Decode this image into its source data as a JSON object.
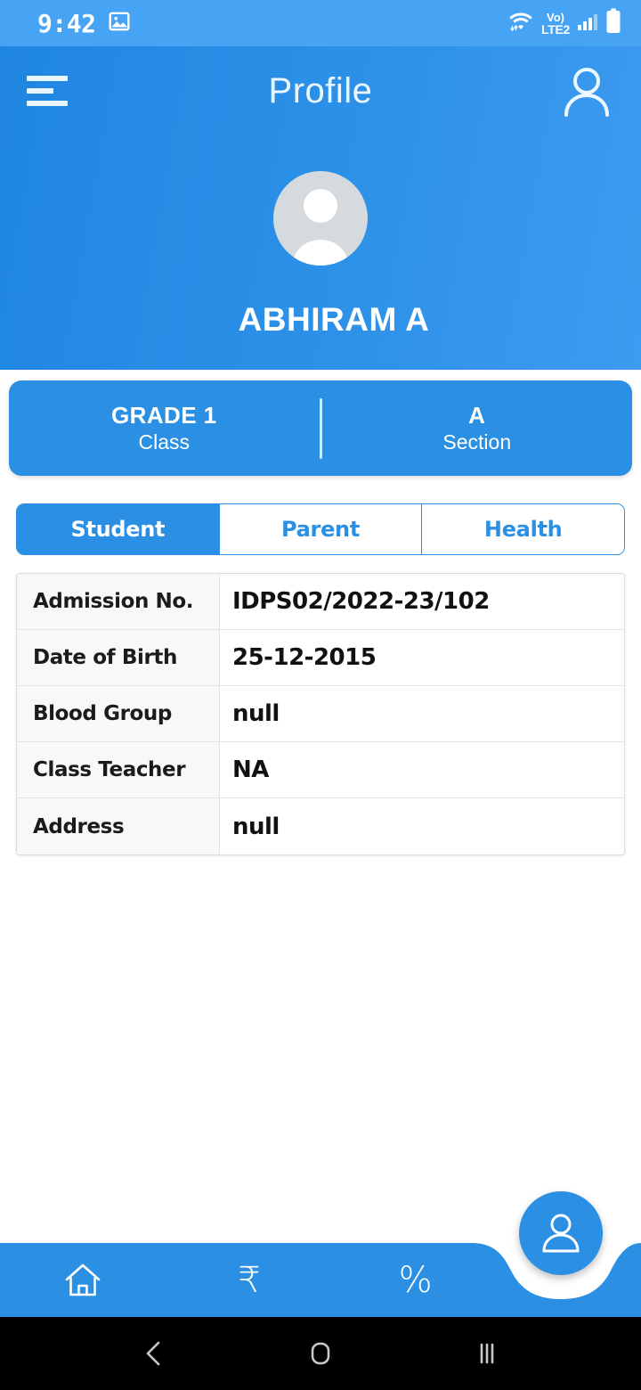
{
  "status_bar": {
    "time": "9:42",
    "icons": [
      "image-icon",
      "wifi-icon",
      "volte-icon",
      "signal-icon",
      "battery-icon"
    ],
    "volte_top": "Vo)",
    "volte_bottom": "LTE2"
  },
  "header": {
    "title": "Profile",
    "menu_icon": "hamburger-icon",
    "profile_icon": "person-icon",
    "student_name": "ABHIRAM A",
    "avatar_icon": "avatar-placeholder-icon",
    "bg_color": "#2b90e4"
  },
  "class_card": {
    "class_value": "GRADE 1",
    "class_label": "Class",
    "section_value": "A",
    "section_label": "Section",
    "bg_color": "#2b90e4"
  },
  "tabs": [
    {
      "label": "Student",
      "active": true
    },
    {
      "label": "Parent",
      "active": false
    },
    {
      "label": "Health",
      "active": false
    }
  ],
  "details": {
    "rows": [
      {
        "label": "Admission No.",
        "value": "IDPS02/2022-23/102"
      },
      {
        "label": "Date of Birth",
        "value": "25-12-2015"
      },
      {
        "label": "Blood Group",
        "value": "null"
      },
      {
        "label": "Class Teacher",
        "value": "NA"
      },
      {
        "label": "Address",
        "value": "null"
      }
    ]
  },
  "bottom_nav": {
    "items": [
      {
        "icon": "home-icon",
        "symbol": ""
      },
      {
        "icon": "rupee-icon",
        "symbol": "₹"
      },
      {
        "icon": "percent-icon",
        "symbol": "%"
      }
    ],
    "fab_icon": "person-icon",
    "bg_color": "#2b90e4"
  },
  "android_nav": {
    "back": "back-icon",
    "home": "home-square-icon",
    "recents": "recents-icon"
  }
}
